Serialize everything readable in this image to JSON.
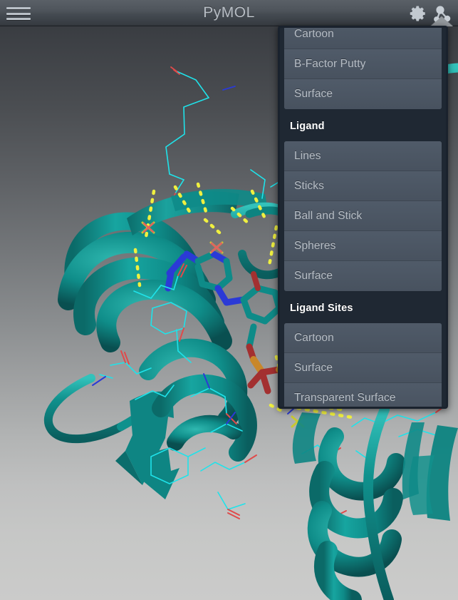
{
  "titlebar": {
    "title": "PyMOL",
    "menu_icon": "hamburger-icon",
    "gear_icon": "gear-icon",
    "atoms_icon": "molecule-icon"
  },
  "popover": {
    "name": "representation-menu-popover",
    "sections": [
      {
        "header": null,
        "items": [
          {
            "label": "Cartoon",
            "clipped": true
          },
          {
            "label": "B-Factor Putty"
          },
          {
            "label": "Surface"
          }
        ]
      },
      {
        "header": "Ligand",
        "items": [
          {
            "label": "Lines"
          },
          {
            "label": "Sticks"
          },
          {
            "label": "Ball and Stick"
          },
          {
            "label": "Spheres"
          },
          {
            "label": "Surface"
          }
        ]
      },
      {
        "header": "Ligand Sites",
        "items": [
          {
            "label": "Cartoon"
          },
          {
            "label": "Surface"
          },
          {
            "label": "Transparent Surface"
          }
        ]
      }
    ]
  },
  "viewport": {
    "name": "molecular-3d-viewport",
    "description": "protein cartoon representation with ligand sticks"
  },
  "colors": {
    "titlebar_top": "#5a6067",
    "titlebar_bottom": "#2c3036",
    "popover_bg": "#1f2833",
    "menu_item_bg": "#4a5563",
    "menu_item_text": "#b8bfc7",
    "section_header_text": "#ffffff",
    "protein_teal": "#0f8a88",
    "ligand_cyan": "#22e0e8",
    "nitrogen_blue": "#2b3ad6",
    "oxygen_red": "#c83232",
    "phosphorus_orange": "#d08a20",
    "hbond_yellow": "#e8e830",
    "bg_top": "#33363b",
    "bg_bottom": "#cbcbca"
  }
}
